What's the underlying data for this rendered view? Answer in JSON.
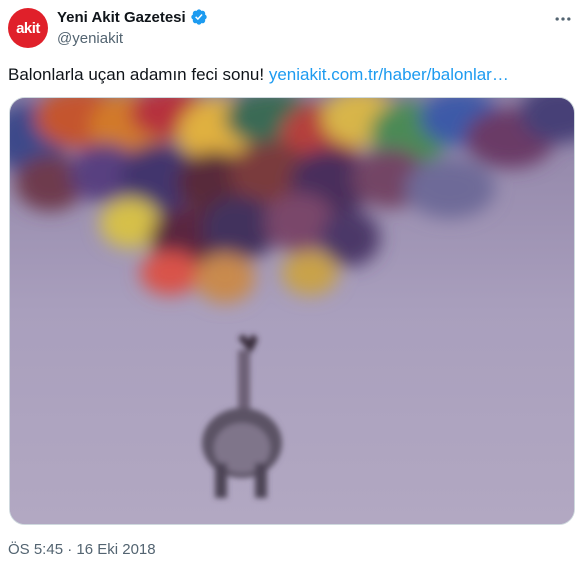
{
  "author": {
    "display_name": "Yeni Akit Gazetesi",
    "handle": "@yeniakit",
    "avatar_text": "akit",
    "avatar_color": "#e0202a",
    "verified_color": "#1d9bf0",
    "verified_icon": "verified-badge-icon"
  },
  "tweet": {
    "text": "Balonlarla uçan adamın feci sonu!",
    "link_text": "yeniakit.com.tr/haber/balonlar…",
    "link_color": "#1d9bf0"
  },
  "media": {
    "image_description_icon": "video-frame"
  },
  "meta": {
    "timestamp": "ÖS 5:45 · 16 Eki 2018"
  },
  "actions": {
    "more_icon": "more-icon"
  }
}
